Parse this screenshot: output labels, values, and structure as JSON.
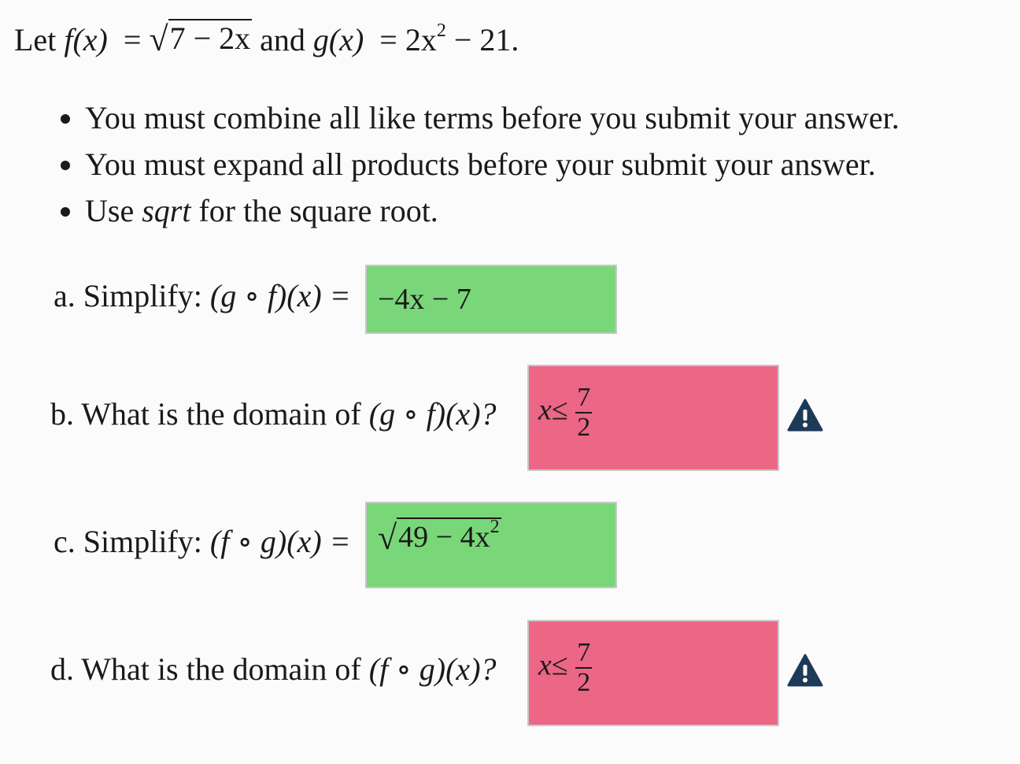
{
  "intro": {
    "prefix": "Let",
    "f_name": "f",
    "f_arg": "(x)",
    "equals": "=",
    "f_radicand": "7 − 2x",
    "conj": "and",
    "g_name": "g",
    "g_arg": "(x)",
    "g_base": "2x",
    "g_exp": "2",
    "g_rest": " − 21."
  },
  "rules": [
    "You must combine all like terms before you submit your answer.",
    "You must expand all products before your submit your answer.",
    "Use sqrt for the square root."
  ],
  "rule3_parts": {
    "before": "Use ",
    "em": "sqrt",
    "after": " for the square root."
  },
  "colors": {
    "correct": "#79d779",
    "incorrect": "#ec6686",
    "warning_icon": "#1d3a57"
  },
  "questions": [
    {
      "label": "a. Simplify: ",
      "expr": "(g ∘ f)(x) =",
      "answer": "−4x − 7",
      "status": "correct"
    },
    {
      "label": "b. What is the domain of ",
      "expr": "(g ∘ f)(x)?",
      "answer_var": "x",
      "answer_rel": "≤",
      "answer_num": "7",
      "answer_den": "2",
      "status": "incorrect",
      "icon": "warning-icon"
    },
    {
      "label": "c. Simplify: ",
      "expr": "(f ∘ g)(x) =",
      "answer_radicand": "49 − 4x",
      "answer_exp": "2",
      "status": "correct"
    },
    {
      "label": "d. What is the domain of ",
      "expr": "(f ∘ g)(x)?",
      "answer_var": "x",
      "answer_rel": "≤",
      "answer_num": "7",
      "answer_den": "2",
      "status": "incorrect",
      "icon": "warning-icon"
    }
  ]
}
